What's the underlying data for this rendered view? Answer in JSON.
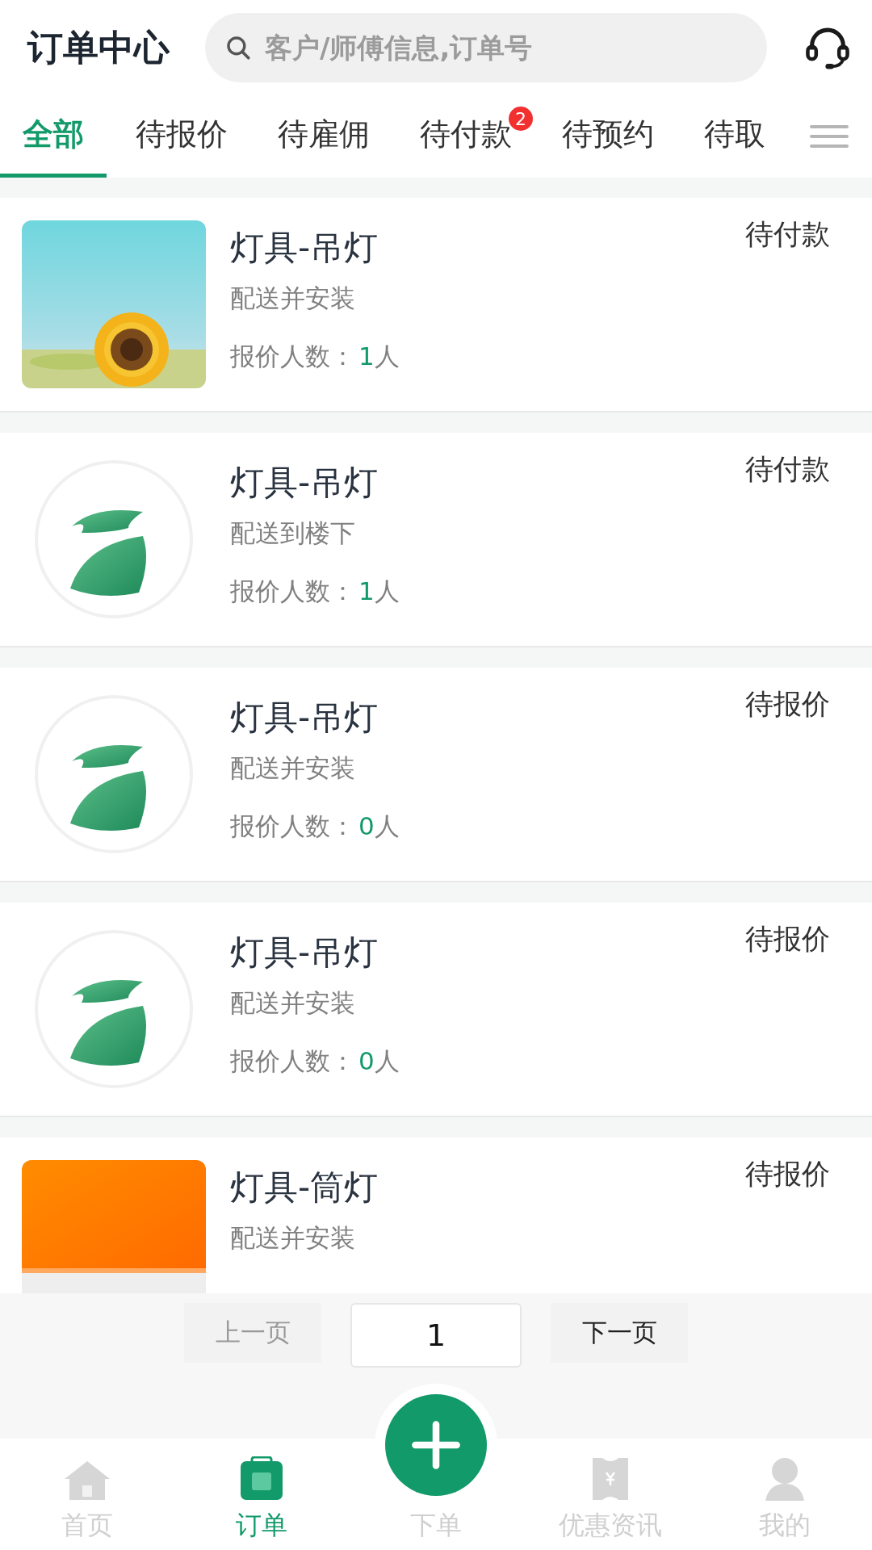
{
  "header": {
    "title": "订单中心",
    "search": {
      "placeholder": "客户/师傅信息,订单号"
    }
  },
  "tabs": [
    {
      "label": "全部",
      "selected": true
    },
    {
      "label": "待报价",
      "selected": false
    },
    {
      "label": "待雇佣",
      "selected": false
    },
    {
      "label": "待付款",
      "selected": false,
      "badge": "2"
    },
    {
      "label": "待预约",
      "selected": false
    },
    {
      "label": "待取",
      "selected": false
    }
  ],
  "orders": [
    {
      "kind": "picture",
      "title": "灯具-吊灯",
      "service": "配送并安装",
      "quote_label": "报价人数：",
      "quote_count": "1",
      "quote_unit": "人",
      "status": "待付款"
    },
    {
      "kind": "logo",
      "title": "灯具-吊灯",
      "service": "配送到楼下",
      "quote_label": "报价人数：",
      "quote_count": "1",
      "quote_unit": "人",
      "status": "待付款"
    },
    {
      "kind": "logo",
      "title": "灯具-吊灯",
      "service": "配送并安装",
      "quote_label": "报价人数：",
      "quote_count": "0",
      "quote_unit": "人",
      "status": "待报价"
    },
    {
      "kind": "logo",
      "title": "灯具-吊灯",
      "service": "配送并安装",
      "quote_label": "报价人数：",
      "quote_count": "0",
      "quote_unit": "人",
      "status": "待报价"
    },
    {
      "kind": "picture",
      "title": "灯具-筒灯",
      "service": "配送并安装",
      "status": "待报价"
    }
  ],
  "pagination": {
    "prev": "上一页",
    "page": "1",
    "next": "下一页"
  },
  "nav": [
    {
      "kind": "home",
      "label": "首页",
      "selected": false
    },
    {
      "kind": "orders",
      "label": "订单",
      "selected": true
    },
    {
      "kind": "add",
      "label": "下单",
      "selected": false
    },
    {
      "kind": "coupon",
      "label": "优惠资讯",
      "selected": false
    },
    {
      "kind": "profile",
      "label": "我的",
      "selected": false
    }
  ]
}
